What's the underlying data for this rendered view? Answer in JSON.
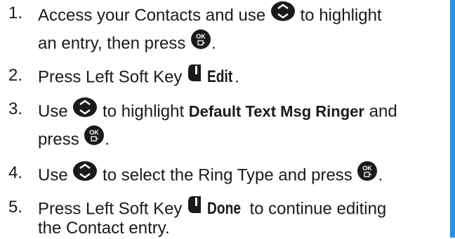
{
  "steps": [
    {
      "num": "1.",
      "a": "Access your Contacts and use",
      "b": "to highlight",
      "c": "an entry, then press",
      "d": "."
    },
    {
      "num": "2.",
      "a": "Press Left Soft Key",
      "b": "Edit",
      "c": "."
    },
    {
      "num": "3.",
      "a": "Use",
      "b": "to highlight",
      "c": "Default Text Msg Ringer",
      "d": "and",
      "e": "press",
      "f": "."
    },
    {
      "num": "4.",
      "a": "Use",
      "b": "to select the Ring Type and press",
      "c": "."
    },
    {
      "num": "5.",
      "a": "Press Left Soft Key",
      "b": "Done",
      "c": "to continue editing",
      "d": "the Contact entry."
    }
  ],
  "icons": {
    "nav": "nav-key-icon",
    "ok": "ok-key-icon",
    "softkey": "left-soft-key-icon",
    "ok_label": "OK"
  },
  "colors": {
    "accent_bar": "#2f8fe0",
    "icon": "#1a1a1a"
  }
}
